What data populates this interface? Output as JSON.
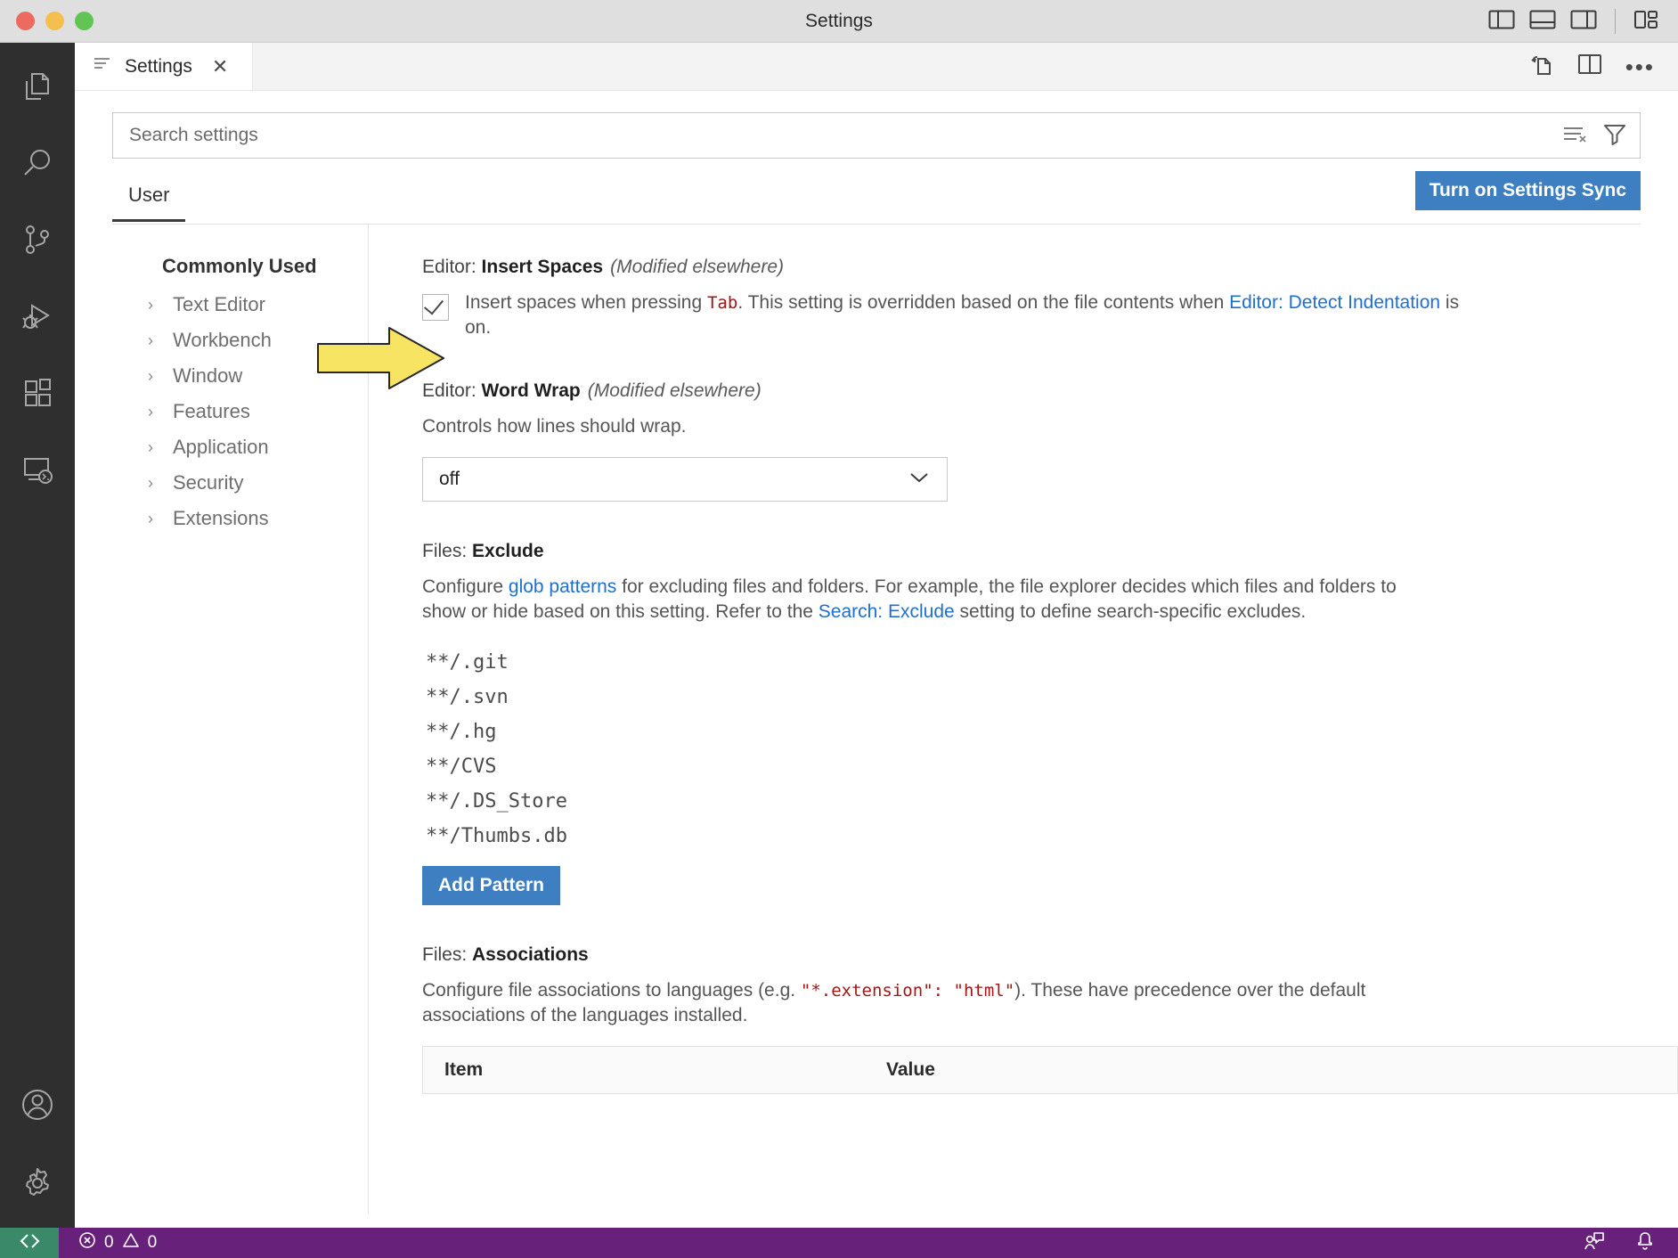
{
  "titlebar": {
    "title": "Settings",
    "traffic_lights": [
      "close",
      "minimize",
      "zoom"
    ],
    "layout_buttons": [
      "toggle-primary-sidebar",
      "toggle-panel",
      "toggle-secondary-sidebar",
      "customize-layout"
    ]
  },
  "activitybar": {
    "top_items": [
      {
        "name": "explorer",
        "label": "Explorer"
      },
      {
        "name": "search",
        "label": "Search"
      },
      {
        "name": "source-control",
        "label": "Source Control"
      },
      {
        "name": "run-and-debug",
        "label": "Run and Debug"
      },
      {
        "name": "extensions",
        "label": "Extensions"
      },
      {
        "name": "remote-explorer",
        "label": "Remote Explorer"
      }
    ],
    "bottom_items": [
      {
        "name": "accounts",
        "label": "Accounts"
      },
      {
        "name": "manage",
        "label": "Manage"
      }
    ]
  },
  "tabbar": {
    "tabs": [
      {
        "label": "Settings",
        "icon": "settings-file-icon",
        "active": true,
        "close": "✕"
      }
    ],
    "actions": [
      "open-settings-json-icon",
      "split-editor-icon",
      "more-actions-icon"
    ],
    "more_glyph": "•••"
  },
  "search": {
    "placeholder": "Search settings",
    "value": "",
    "clear_filters_icon": "clear-settings-search-icon",
    "filter_icon": "filter-icon"
  },
  "scope": {
    "tabs": [
      {
        "label": "User",
        "active": true
      }
    ],
    "sync_button": "Turn on Settings Sync",
    "sync_button_color": "#3e7fc1"
  },
  "toc": {
    "title": "Commonly Used",
    "items": [
      {
        "label": "Text Editor"
      },
      {
        "label": "Workbench"
      },
      {
        "label": "Window"
      },
      {
        "label": "Features"
      },
      {
        "label": "Application"
      },
      {
        "label": "Security"
      },
      {
        "label": "Extensions"
      }
    ],
    "chevron": "›"
  },
  "settings": {
    "insert_spaces": {
      "prefix": "Editor: ",
      "name": "Insert Spaces",
      "modified": "(Modified elsewhere)",
      "checked": true,
      "desc_1": "Insert spaces when pressing ",
      "code_tab": "Tab",
      "desc_2": ". This setting is overridden based on the file contents when ",
      "link_1": "Editor: Detect Indentation",
      "desc_3": " is on."
    },
    "word_wrap": {
      "prefix": "Editor: ",
      "name": "Word Wrap",
      "modified": "(Modified elsewhere)",
      "description": "Controls how lines should wrap.",
      "value": "off",
      "chevron": "⌄"
    },
    "files_exclude": {
      "prefix": "Files: ",
      "name": "Exclude",
      "desc_1": "Configure ",
      "link_1": "glob patterns",
      "desc_2": " for excluding files and folders. For example, the file explorer decides which files and folders to show or hide based on this setting. Refer to the ",
      "link_2": "Search: Exclude",
      "desc_3": " setting to define search-specific excludes.",
      "patterns": [
        "**/.git",
        "**/.svn",
        "**/.hg",
        "**/CVS",
        "**/.DS_Store",
        "**/Thumbs.db"
      ],
      "add_button": "Add Pattern"
    },
    "files_associations": {
      "prefix": "Files: ",
      "name": "Associations",
      "desc_1": "Configure file associations to languages (e.g. ",
      "code_1": "\"*.extension\": \"html\"",
      "desc_2": "). These have precedence over the default associations of the languages installed.",
      "table_headers": [
        "Item",
        "Value"
      ]
    }
  },
  "annotation": {
    "arrow": "pointing-right-arrow",
    "color": "#f7e463",
    "target": "insert-spaces-checkbox"
  },
  "statusbar": {
    "remote_icon": "remote-host-icon",
    "errors": "0",
    "warnings": "0",
    "error_icon": "error-icon",
    "warning_icon": "warning-icon",
    "feedback_icon": "feedback-icon",
    "bell_icon": "notifications-bell-icon",
    "background": "#68217a",
    "remote_background": "#3a8a6a"
  }
}
